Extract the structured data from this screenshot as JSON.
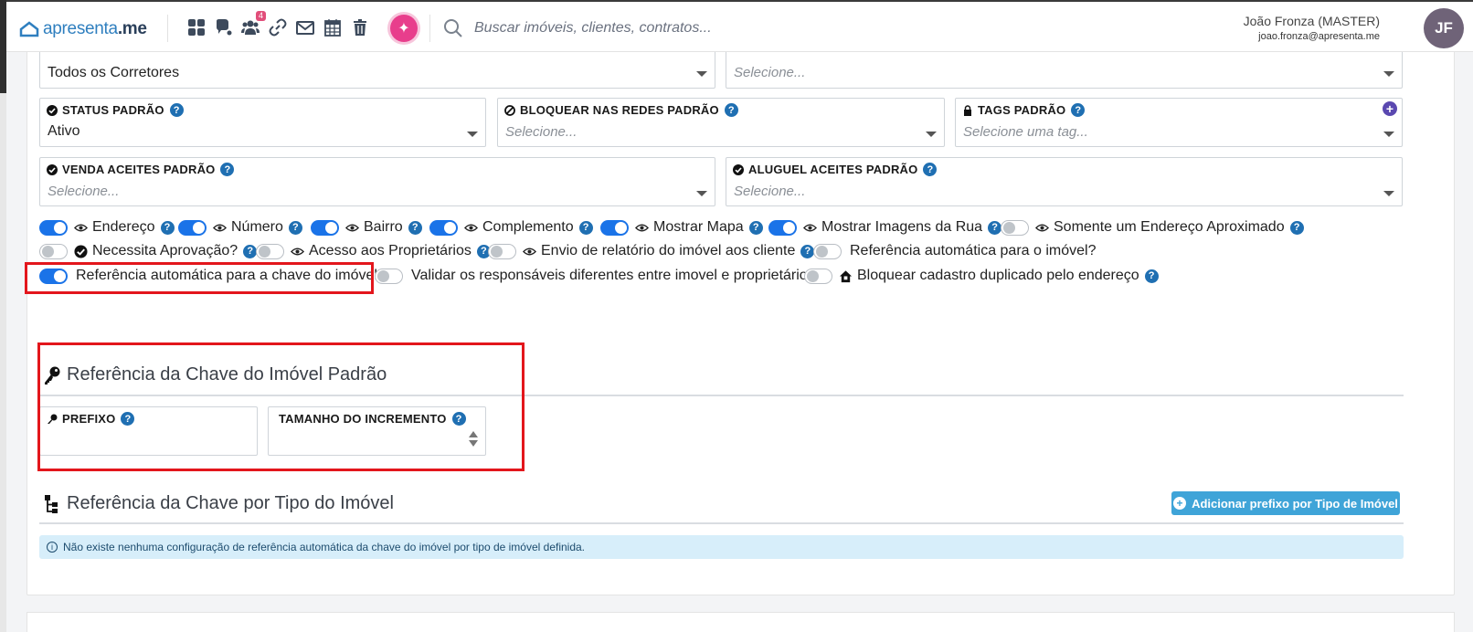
{
  "brand": {
    "name_part1": "apresenta",
    "name_part2": ".me"
  },
  "nav": {
    "badge_count": "4",
    "search_placeholder": "Buscar imóveis, clientes, contratos..."
  },
  "user": {
    "name": "João Fronza (MASTER)",
    "email": "joao.fronza@apresenta.me",
    "initials": "JF"
  },
  "fields": {
    "top_left_value": "Todos os Corretores",
    "top_right_placeholder": "Selecione...",
    "status": {
      "label": "STATUS PADRÃO",
      "value": "Ativo"
    },
    "bloquear": {
      "label": "BLOQUEAR NAS REDES PADRÃO",
      "placeholder": "Selecione..."
    },
    "tags": {
      "label": "TAGS PADRÃO",
      "placeholder": "Selecione uma tag..."
    },
    "venda": {
      "label": "VENDA ACEITES PADRÃO",
      "placeholder": "Selecione..."
    },
    "aluguel": {
      "label": "ALUGUEL ACEITES PADRÃO",
      "placeholder": "Selecione..."
    }
  },
  "toggles": {
    "row1": [
      {
        "label": "Endereço",
        "on": true
      },
      {
        "label": "Número",
        "on": true
      },
      {
        "label": "Bairro",
        "on": true
      },
      {
        "label": "Complemento",
        "on": true
      },
      {
        "label": "Mostrar Mapa",
        "on": true
      },
      {
        "label": "Mostrar Imagens da Rua",
        "on": true
      },
      {
        "label": "Somente um Endereço Aproximado",
        "on": false
      }
    ],
    "row2": [
      {
        "label": "Necessita Aprovação?",
        "on": false
      },
      {
        "label": "Acesso aos Proprietários",
        "on": false
      },
      {
        "label": "Envio de relatório do imóvel aos cliente",
        "on": false
      },
      {
        "label": "Referência automática para o imóvel?",
        "on": false
      }
    ],
    "row3": [
      {
        "label": "Referência automática para a chave do imóvel?",
        "on": true
      },
      {
        "label": "Validar os responsáveis diferentes entre imovel e proprietário?",
        "on": false
      },
      {
        "label": "Bloquear cadastro duplicado pelo endereço",
        "on": false
      }
    ]
  },
  "section_key": {
    "title": "Referência da Chave do Imóvel Padrão",
    "prefixo_label": "PREFIXO",
    "incremento_label": "TAMANHO DO INCREMENTO"
  },
  "section_type": {
    "title": "Referência da Chave por Tipo do Imóvel",
    "add_button": "Adicionar prefixo por Tipo de Imóvel",
    "alert": "Não existe nenhuma configuração de referência automática da chave do imóvel por tipo de imóvel definida."
  },
  "help_glyph": "?",
  "plus_glyph": "+",
  "info_glyph": "i"
}
